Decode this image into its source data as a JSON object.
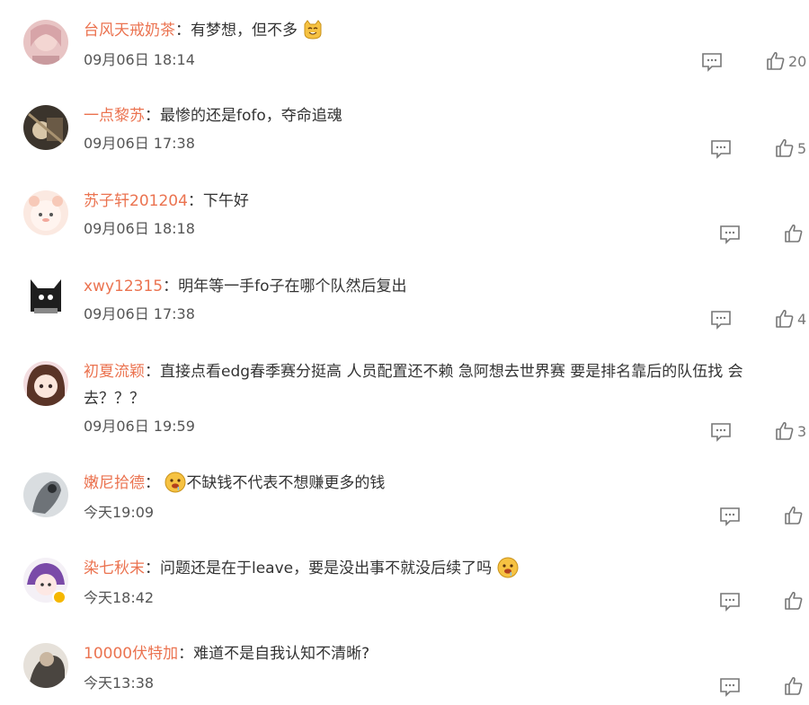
{
  "comments": [
    {
      "username": "台风天戒奶茶",
      "text": "有梦想，但不多",
      "time": "09月06日 18:14",
      "likes": "20",
      "emoji": "grin-cat-emoji"
    },
    {
      "username": "一点黎苏",
      "text": "最惨的还是fofo，夺命追魂",
      "time": "09月06日 17:38",
      "likes": "5"
    },
    {
      "username": "苏子轩201204",
      "text": "下午好",
      "time": "09月06日 18:18",
      "likes": ""
    },
    {
      "username": "xwy12315",
      "text": "明年等一手fo子在哪个队然后复出",
      "time": "09月06日 17:38",
      "likes": "4"
    },
    {
      "username": "初夏流颖",
      "text": "直接点看edg春季赛分挺高 人员配置还不赖 急阿想去世界赛 要是排名靠后的队伍找 会去？？？",
      "time": "09月06日 19:59",
      "likes": "3"
    },
    {
      "username": "嫩尼拾德",
      "text": "不缺钱不代表不想赚更多的钱",
      "time": "今天19:09",
      "likes": "",
      "emoji_before": "drool-emoji"
    },
    {
      "username": "染七秋末",
      "text": "问题还是在于leave，要是没出事不就没后续了吗",
      "time": "今天18:42",
      "likes": "",
      "emoji": "drool-emoji"
    },
    {
      "username": "10000伏特加",
      "text": "难道不是自我认知不清晰?",
      "time": "今天13:38",
      "likes": ""
    }
  ],
  "separator": "：",
  "colors": {
    "username": "#eb7350",
    "text": "#333333",
    "time": "#555555",
    "icon": "#777777"
  }
}
